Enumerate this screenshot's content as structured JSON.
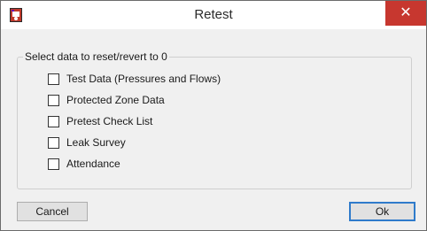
{
  "window": {
    "title": "Retest",
    "close_glyph": "✕"
  },
  "group": {
    "legend": "Select data to reset/revert to 0"
  },
  "options": [
    {
      "label": "Test Data (Pressures and Flows)",
      "checked": false
    },
    {
      "label": "Protected Zone Data",
      "checked": false
    },
    {
      "label": "Pretest Check List",
      "checked": false
    },
    {
      "label": "Leak Survey",
      "checked": false
    },
    {
      "label": "Attendance",
      "checked": false
    }
  ],
  "buttons": {
    "cancel_label": "Cancel",
    "ok_label": "Ok"
  },
  "colors": {
    "close_button": "#c7372f",
    "default_button_border": "#2f7bcb",
    "dialog_background": "#f0f0f0"
  }
}
